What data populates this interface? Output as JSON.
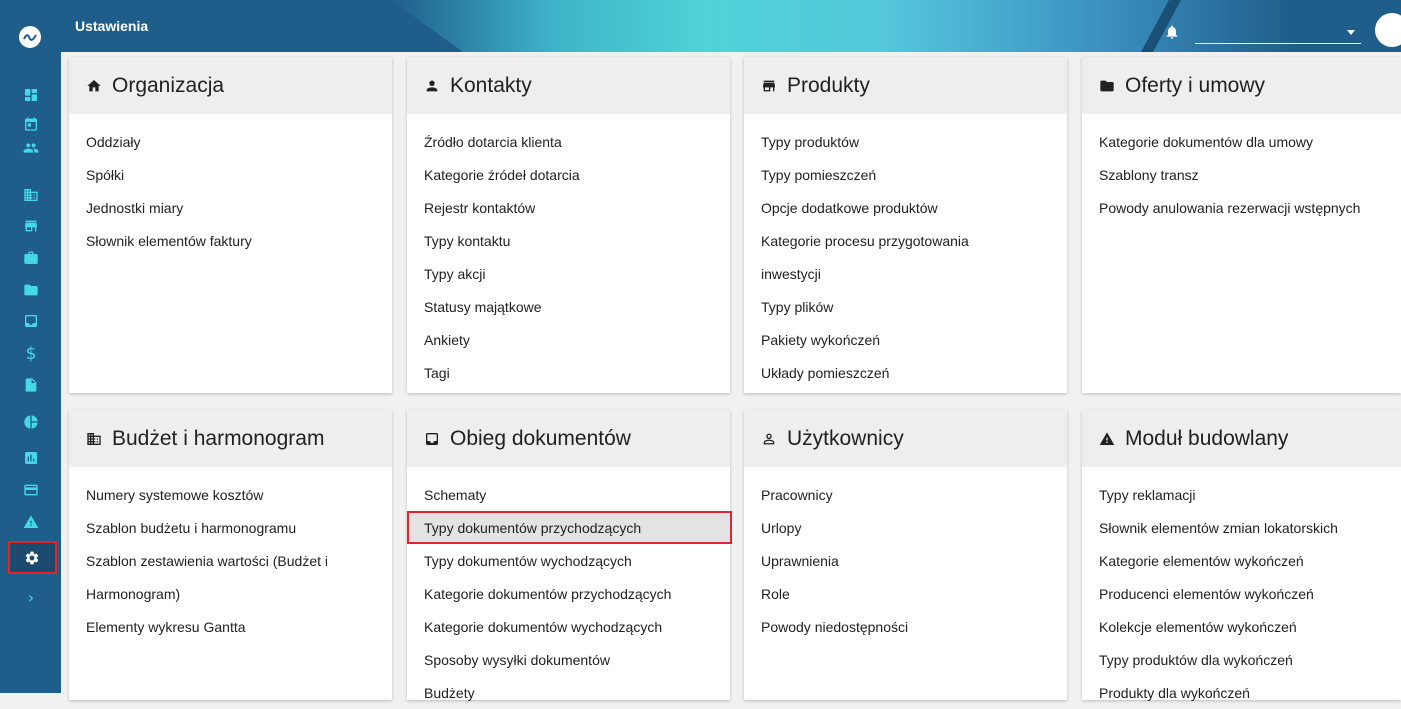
{
  "header": {
    "title": "Ustawienia",
    "user_value": ""
  },
  "sidebar": {
    "icons": [
      "logo-icon",
      "dashboard-icon",
      "calendar-icon",
      "contacts-icon",
      "building-icon",
      "store-icon",
      "briefcase-icon",
      "folder-icon",
      "inbox-icon",
      "dollar-icon",
      "document-icon",
      "pie-chart-icon",
      "bar-chart-icon",
      "card-icon",
      "warning-icon",
      "settings-icon",
      "expand-icon"
    ],
    "active": "settings-icon"
  },
  "cards": [
    {
      "title": "Organizacja",
      "icon": "home-icon",
      "items": [
        "Oddziały",
        "Spółki",
        "Jednostki miary",
        "Słownik elementów faktury"
      ]
    },
    {
      "title": "Kontakty",
      "icon": "person-icon",
      "items": [
        "Źródło dotarcia klienta",
        "Kategorie źródeł dotarcia",
        "Rejestr kontaktów",
        "Typy kontaktu",
        "Typy akcji",
        "Statusy majątkowe",
        "Ankiety",
        "Tagi"
      ]
    },
    {
      "title": "Produkty",
      "icon": "store-icon",
      "items": [
        "Typy produktów",
        "Typy pomieszczeń",
        "Opcje dodatkowe produktów",
        "Kategorie procesu przygotowania",
        "inwestycji",
        "Typy plików",
        "Pakiety wykończeń",
        "Układy pomieszczeń"
      ]
    },
    {
      "title": "Oferty i umowy",
      "icon": "folder-icon",
      "items": [
        "Kategorie dokumentów dla umowy",
        "Szablony transz",
        "Powody anulowania rezerwacji wstępnych"
      ]
    },
    {
      "title": "Budżet i harmonogram",
      "icon": "building-icon",
      "items": [
        "Numery systemowe kosztów",
        "Szablon budżetu i harmonogramu",
        "Szablon zestawienia wartości (Budżet i",
        "Harmonogram)",
        "Elementy wykresu Gantta"
      ]
    },
    {
      "title": "Obieg dokumentów",
      "icon": "inbox-icon",
      "items": [
        "Schematy",
        "Typy dokumentów przychodzących",
        "Typy dokumentów wychodzących",
        "Kategorie dokumentów przychodzących",
        "Kategorie dokumentów wychodzących",
        "Sposoby wysyłki dokumentów",
        "Budżety"
      ],
      "selected_index": 1
    },
    {
      "title": "Użytkownicy",
      "icon": "person-outline-icon",
      "items": [
        "Pracownicy",
        "Urlopy",
        "Uprawnienia",
        "Role",
        "Powody niedostępności"
      ]
    },
    {
      "title": "Moduł budowlany",
      "icon": "warning-icon",
      "items": [
        "Typy reklamacji",
        "Słownik elementów zmian lokatorskich",
        "Kategorie elementów wykończeń",
        "Producenci elementów wykończeń",
        "Kolekcje elementów wykończeń",
        "Typy produktów dla wykończeń",
        "Produkty dla wykończeń"
      ]
    }
  ],
  "colors": {
    "sidebar": "#1f5e8a",
    "accent": "#46d8e6",
    "highlight": "#e0262b"
  }
}
